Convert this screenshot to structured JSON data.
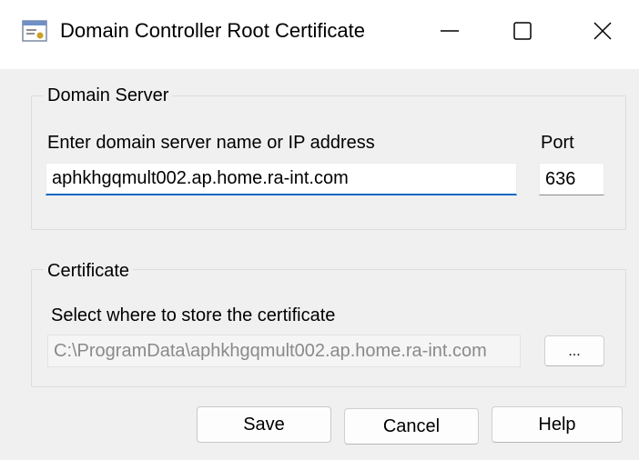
{
  "window": {
    "title": "Domain Controller Root Certificate",
    "icons": {
      "app": "window-app-icon",
      "minimize": "minimize-icon",
      "maximize": "maximize-icon",
      "close": "close-icon"
    }
  },
  "domain_server": {
    "group_label": "Domain Server",
    "name_label": "Enter domain server name or IP address",
    "name_value": "aphkhgqmult002.ap.home.ra-int.com",
    "port_label": "Port",
    "port_value": "636"
  },
  "certificate": {
    "group_label": "Certificate",
    "path_label": "Select where to store the certificate",
    "path_value": "C:\\ProgramData\\aphkhgqmult002.ap.home.ra-int.com",
    "browse_label": "..."
  },
  "buttons": {
    "save": "Save",
    "cancel": "Cancel",
    "help": "Help"
  },
  "colors": {
    "focus_accent": "#0067c0",
    "background": "#f0f0f0"
  }
}
